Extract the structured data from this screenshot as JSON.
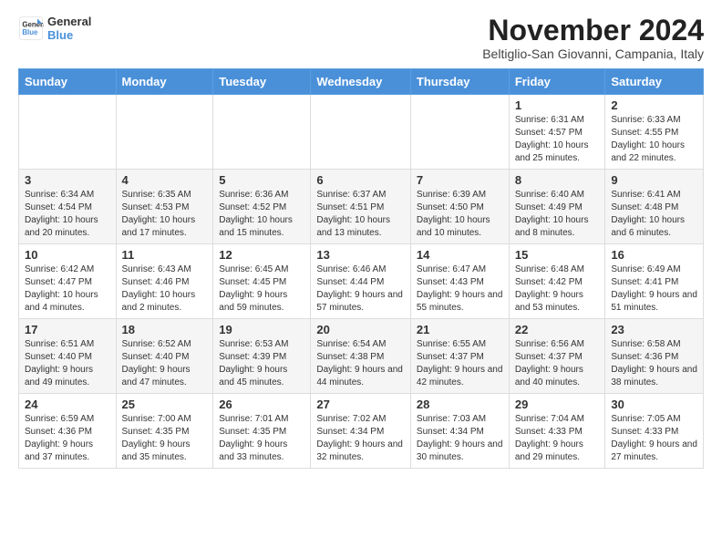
{
  "header": {
    "logo_line1": "General",
    "logo_line2": "Blue",
    "month_title": "November 2024",
    "subtitle": "Beltiglio-San Giovanni, Campania, Italy"
  },
  "days_of_week": [
    "Sunday",
    "Monday",
    "Tuesday",
    "Wednesday",
    "Thursday",
    "Friday",
    "Saturday"
  ],
  "weeks": [
    [
      {
        "day": "",
        "info": ""
      },
      {
        "day": "",
        "info": ""
      },
      {
        "day": "",
        "info": ""
      },
      {
        "day": "",
        "info": ""
      },
      {
        "day": "",
        "info": ""
      },
      {
        "day": "1",
        "info": "Sunrise: 6:31 AM\nSunset: 4:57 PM\nDaylight: 10 hours and 25 minutes."
      },
      {
        "day": "2",
        "info": "Sunrise: 6:33 AM\nSunset: 4:55 PM\nDaylight: 10 hours and 22 minutes."
      }
    ],
    [
      {
        "day": "3",
        "info": "Sunrise: 6:34 AM\nSunset: 4:54 PM\nDaylight: 10 hours and 20 minutes."
      },
      {
        "day": "4",
        "info": "Sunrise: 6:35 AM\nSunset: 4:53 PM\nDaylight: 10 hours and 17 minutes."
      },
      {
        "day": "5",
        "info": "Sunrise: 6:36 AM\nSunset: 4:52 PM\nDaylight: 10 hours and 15 minutes."
      },
      {
        "day": "6",
        "info": "Sunrise: 6:37 AM\nSunset: 4:51 PM\nDaylight: 10 hours and 13 minutes."
      },
      {
        "day": "7",
        "info": "Sunrise: 6:39 AM\nSunset: 4:50 PM\nDaylight: 10 hours and 10 minutes."
      },
      {
        "day": "8",
        "info": "Sunrise: 6:40 AM\nSunset: 4:49 PM\nDaylight: 10 hours and 8 minutes."
      },
      {
        "day": "9",
        "info": "Sunrise: 6:41 AM\nSunset: 4:48 PM\nDaylight: 10 hours and 6 minutes."
      }
    ],
    [
      {
        "day": "10",
        "info": "Sunrise: 6:42 AM\nSunset: 4:47 PM\nDaylight: 10 hours and 4 minutes."
      },
      {
        "day": "11",
        "info": "Sunrise: 6:43 AM\nSunset: 4:46 PM\nDaylight: 10 hours and 2 minutes."
      },
      {
        "day": "12",
        "info": "Sunrise: 6:45 AM\nSunset: 4:45 PM\nDaylight: 9 hours and 59 minutes."
      },
      {
        "day": "13",
        "info": "Sunrise: 6:46 AM\nSunset: 4:44 PM\nDaylight: 9 hours and 57 minutes."
      },
      {
        "day": "14",
        "info": "Sunrise: 6:47 AM\nSunset: 4:43 PM\nDaylight: 9 hours and 55 minutes."
      },
      {
        "day": "15",
        "info": "Sunrise: 6:48 AM\nSunset: 4:42 PM\nDaylight: 9 hours and 53 minutes."
      },
      {
        "day": "16",
        "info": "Sunrise: 6:49 AM\nSunset: 4:41 PM\nDaylight: 9 hours and 51 minutes."
      }
    ],
    [
      {
        "day": "17",
        "info": "Sunrise: 6:51 AM\nSunset: 4:40 PM\nDaylight: 9 hours and 49 minutes."
      },
      {
        "day": "18",
        "info": "Sunrise: 6:52 AM\nSunset: 4:40 PM\nDaylight: 9 hours and 47 minutes."
      },
      {
        "day": "19",
        "info": "Sunrise: 6:53 AM\nSunset: 4:39 PM\nDaylight: 9 hours and 45 minutes."
      },
      {
        "day": "20",
        "info": "Sunrise: 6:54 AM\nSunset: 4:38 PM\nDaylight: 9 hours and 44 minutes."
      },
      {
        "day": "21",
        "info": "Sunrise: 6:55 AM\nSunset: 4:37 PM\nDaylight: 9 hours and 42 minutes."
      },
      {
        "day": "22",
        "info": "Sunrise: 6:56 AM\nSunset: 4:37 PM\nDaylight: 9 hours and 40 minutes."
      },
      {
        "day": "23",
        "info": "Sunrise: 6:58 AM\nSunset: 4:36 PM\nDaylight: 9 hours and 38 minutes."
      }
    ],
    [
      {
        "day": "24",
        "info": "Sunrise: 6:59 AM\nSunset: 4:36 PM\nDaylight: 9 hours and 37 minutes."
      },
      {
        "day": "25",
        "info": "Sunrise: 7:00 AM\nSunset: 4:35 PM\nDaylight: 9 hours and 35 minutes."
      },
      {
        "day": "26",
        "info": "Sunrise: 7:01 AM\nSunset: 4:35 PM\nDaylight: 9 hours and 33 minutes."
      },
      {
        "day": "27",
        "info": "Sunrise: 7:02 AM\nSunset: 4:34 PM\nDaylight: 9 hours and 32 minutes."
      },
      {
        "day": "28",
        "info": "Sunrise: 7:03 AM\nSunset: 4:34 PM\nDaylight: 9 hours and 30 minutes."
      },
      {
        "day": "29",
        "info": "Sunrise: 7:04 AM\nSunset: 4:33 PM\nDaylight: 9 hours and 29 minutes."
      },
      {
        "day": "30",
        "info": "Sunrise: 7:05 AM\nSunset: 4:33 PM\nDaylight: 9 hours and 27 minutes."
      }
    ]
  ]
}
